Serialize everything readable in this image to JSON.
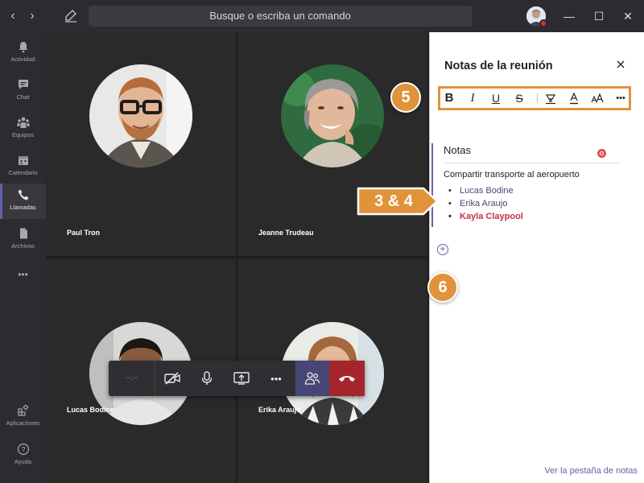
{
  "titlebar": {
    "search_placeholder": "Busque o escriba un comando",
    "back_icon": "chevron-left-icon",
    "forward_icon": "chevron-right-icon",
    "compose_icon": "compose-icon"
  },
  "rail": {
    "items": [
      {
        "label": "Actividad",
        "icon": "bell-icon"
      },
      {
        "label": "Chat",
        "icon": "chat-icon"
      },
      {
        "label": "Equipos",
        "icon": "teams-icon"
      },
      {
        "label": "Calendario",
        "icon": "calendar-icon"
      },
      {
        "label": "Llamadas",
        "icon": "phone-icon",
        "active": true
      },
      {
        "label": "Archivos",
        "icon": "file-icon"
      },
      {
        "label": "Aplicaciones",
        "icon": "apps-icon"
      },
      {
        "label": "Ayuda",
        "icon": "help-icon"
      }
    ],
    "more_label": "•••"
  },
  "participants": [
    {
      "name": "Paul Tron"
    },
    {
      "name": "Jeanne Trudeau"
    },
    {
      "name": "Lucas Bodine"
    },
    {
      "name": "Erika Araujo"
    }
  ],
  "controls": {
    "timer": "--:--",
    "more_label": "•••"
  },
  "notes": {
    "title": "Notas de la reunión",
    "section_title": "Notas",
    "text": "Compartir transporte al aeropuerto",
    "bullets": [
      "Lucas Bodine",
      "Erika Araujo",
      "Kayla Claypool"
    ],
    "add_label": "+",
    "link": "Ver la pestaña de notas",
    "toolbar": {
      "bold": "B",
      "italic": "I",
      "underline": "U",
      "strike": "S",
      "more": "•••"
    }
  },
  "callouts": {
    "toolbar": "5",
    "notes": "3 & 4",
    "add": "6"
  },
  "colors": {
    "accent": "#6264a7",
    "callout": "#e1933b",
    "highlight": "#c4314b",
    "hangup": "#a4262c"
  }
}
